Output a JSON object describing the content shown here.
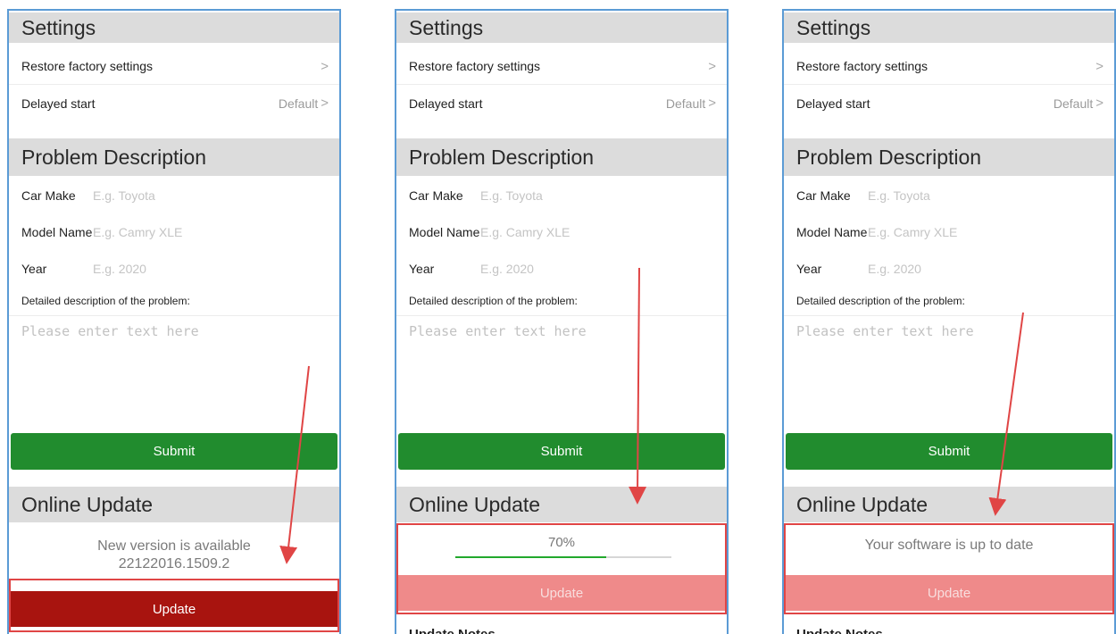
{
  "panels": [
    {
      "settings": {
        "title": "Settings",
        "restore": "Restore factory settings",
        "restore_chevron": ">",
        "delay": "Delayed start",
        "delay_value": "Default",
        "delay_chevron": ">"
      },
      "problem": {
        "title": "Problem Description",
        "car_make_label": "Car Make",
        "car_make_placeholder": "E.g. Toyota",
        "model_label": "Model Name",
        "model_placeholder": "E.g. Camry XLE",
        "year_label": "Year",
        "year_placeholder": "E.g. 2020",
        "desc_label": "Detailed description of the problem:",
        "desc_placeholder": "Please enter text here",
        "submit": "Submit"
      },
      "update": {
        "title": "Online Update",
        "status_line1": "New version is available",
        "status_line2": "22122016.1509.2",
        "button": "Update"
      }
    },
    {
      "settings": {
        "title": "Settings",
        "restore": "Restore factory settings",
        "restore_chevron": ">",
        "delay": "Delayed start",
        "delay_value": "Default",
        "delay_chevron": ">"
      },
      "problem": {
        "title": "Problem Description",
        "car_make_label": "Car Make",
        "car_make_placeholder": "E.g. Toyota",
        "model_label": "Model Name",
        "model_placeholder": "E.g. Camry XLE",
        "year_label": "Year",
        "year_placeholder": "E.g. 2020",
        "desc_label": "Detailed description of the problem:",
        "desc_placeholder": "Please enter text here",
        "submit": "Submit"
      },
      "update": {
        "title": "Online Update",
        "progress_text": "70%",
        "progress_fraction": 0.7,
        "button": "Update",
        "notes_title": "Update Notes"
      }
    },
    {
      "settings": {
        "title": "Settings",
        "restore": "Restore factory settings",
        "restore_chevron": ">",
        "delay": "Delayed start",
        "delay_value": "Default",
        "delay_chevron": ">"
      },
      "problem": {
        "title": "Problem Description",
        "car_make_label": "Car Make",
        "car_make_placeholder": "E.g. Toyota",
        "model_label": "Model Name",
        "model_placeholder": "E.g. Camry XLE",
        "year_label": "Year",
        "year_placeholder": "E.g. 2020",
        "desc_label": "Detailed description of the problem:",
        "desc_placeholder": "Please enter text here",
        "submit": "Submit"
      },
      "update": {
        "title": "Online Update",
        "status_line1": "Your software is up to date",
        "button": "Update",
        "notes_title": "Update Notes"
      }
    }
  ],
  "colors": {
    "panel_border": "#5b9bd5",
    "section_header_bg": "#dcdcdc",
    "submit_green": "#218c2e",
    "update_active_red": "#a8140f",
    "update_disabled_pink": "#ef8a8a",
    "progress_green": "#22a82c",
    "annotation_red": "#e04545"
  }
}
